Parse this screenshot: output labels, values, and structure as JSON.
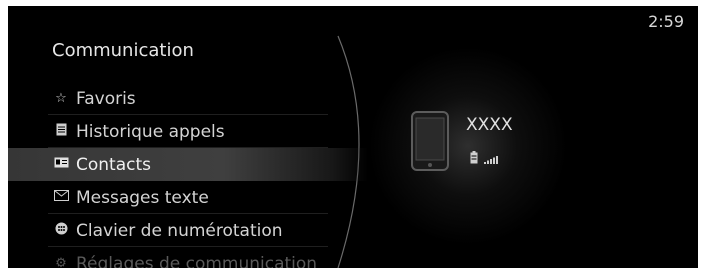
{
  "header": {
    "clock": "2:59",
    "title": "Communication"
  },
  "menu": {
    "items": [
      {
        "icon": "star-icon",
        "label": "Favoris"
      },
      {
        "icon": "call-history-icon",
        "label": "Historique appels"
      },
      {
        "icon": "contacts-icon",
        "label": "Contacts",
        "selected": true
      },
      {
        "icon": "envelope-icon",
        "label": "Messages texte"
      },
      {
        "icon": "dial-pad-icon",
        "label": "Clavier de numérotation"
      },
      {
        "icon": "gear-icon",
        "label": "Réglages de communication"
      }
    ]
  },
  "device": {
    "name": "XXXX",
    "icon": "smartphone-icon",
    "battery_icon": "battery-icon",
    "signal_icon": "signal-icon"
  },
  "colors": {
    "background": "#000000",
    "text": "#d4d4d4",
    "highlight": "#464646"
  }
}
